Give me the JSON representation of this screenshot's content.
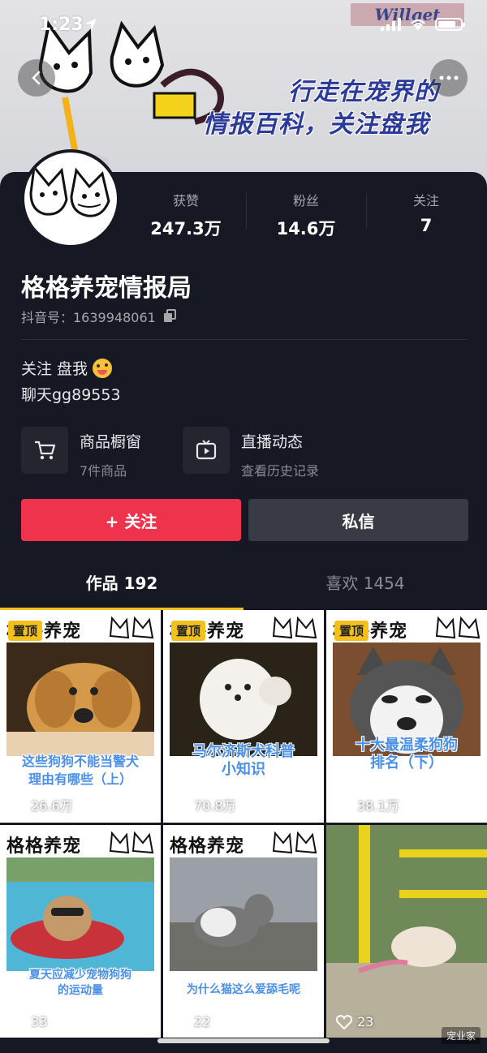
{
  "status_bar": {
    "time": "1:23"
  },
  "cover": {
    "brand": "Willget",
    "line1": "行走在宠界的",
    "line2": "情报百科，关注盘我"
  },
  "profile": {
    "stats": [
      {
        "label": "获赞",
        "value": "247.3万"
      },
      {
        "label": "粉丝",
        "value": "14.6万"
      },
      {
        "label": "关注",
        "value": "7"
      }
    ],
    "name": "格格养宠情报局",
    "douyin_id": "抖音号：1639948061",
    "bio_line1": "关注 盘我",
    "bio_line2": "聊天gg89553"
  },
  "features": {
    "shop": {
      "title": "商品橱窗",
      "subtitle": "7件商品"
    },
    "live": {
      "title": "直播动态",
      "subtitle": "查看历史记录"
    }
  },
  "actions": {
    "follow": "+ 关注",
    "message": "私信"
  },
  "tabs": [
    {
      "label": "作品 192"
    },
    {
      "label": "喜欢 1454"
    }
  ],
  "videos": [
    {
      "header": "格格养宠",
      "pinned": "置顶",
      "caption": "这些狗狗不能当警犬\n理由有哪些（上）",
      "likes": "26.6万"
    },
    {
      "header": "格格养宠",
      "pinned": "置顶",
      "caption": "马尔济斯犬科普\n小知识",
      "likes": "70.8万"
    },
    {
      "header": "格格养宠",
      "pinned": "置顶",
      "caption": "十大最温柔狗狗\n排名（下）",
      "likes": "38.1万"
    },
    {
      "header": "格格养宠",
      "pinned": "",
      "caption": "夏天应减少宠物狗狗\n的运动量",
      "likes": "33"
    },
    {
      "header": "格格养宠",
      "pinned": "",
      "caption": "为什么猫这么爱舔毛呢",
      "likes": "22"
    },
    {
      "header": "",
      "pinned": "",
      "caption": "",
      "likes": "23"
    }
  ],
  "watermark": "宠业家"
}
